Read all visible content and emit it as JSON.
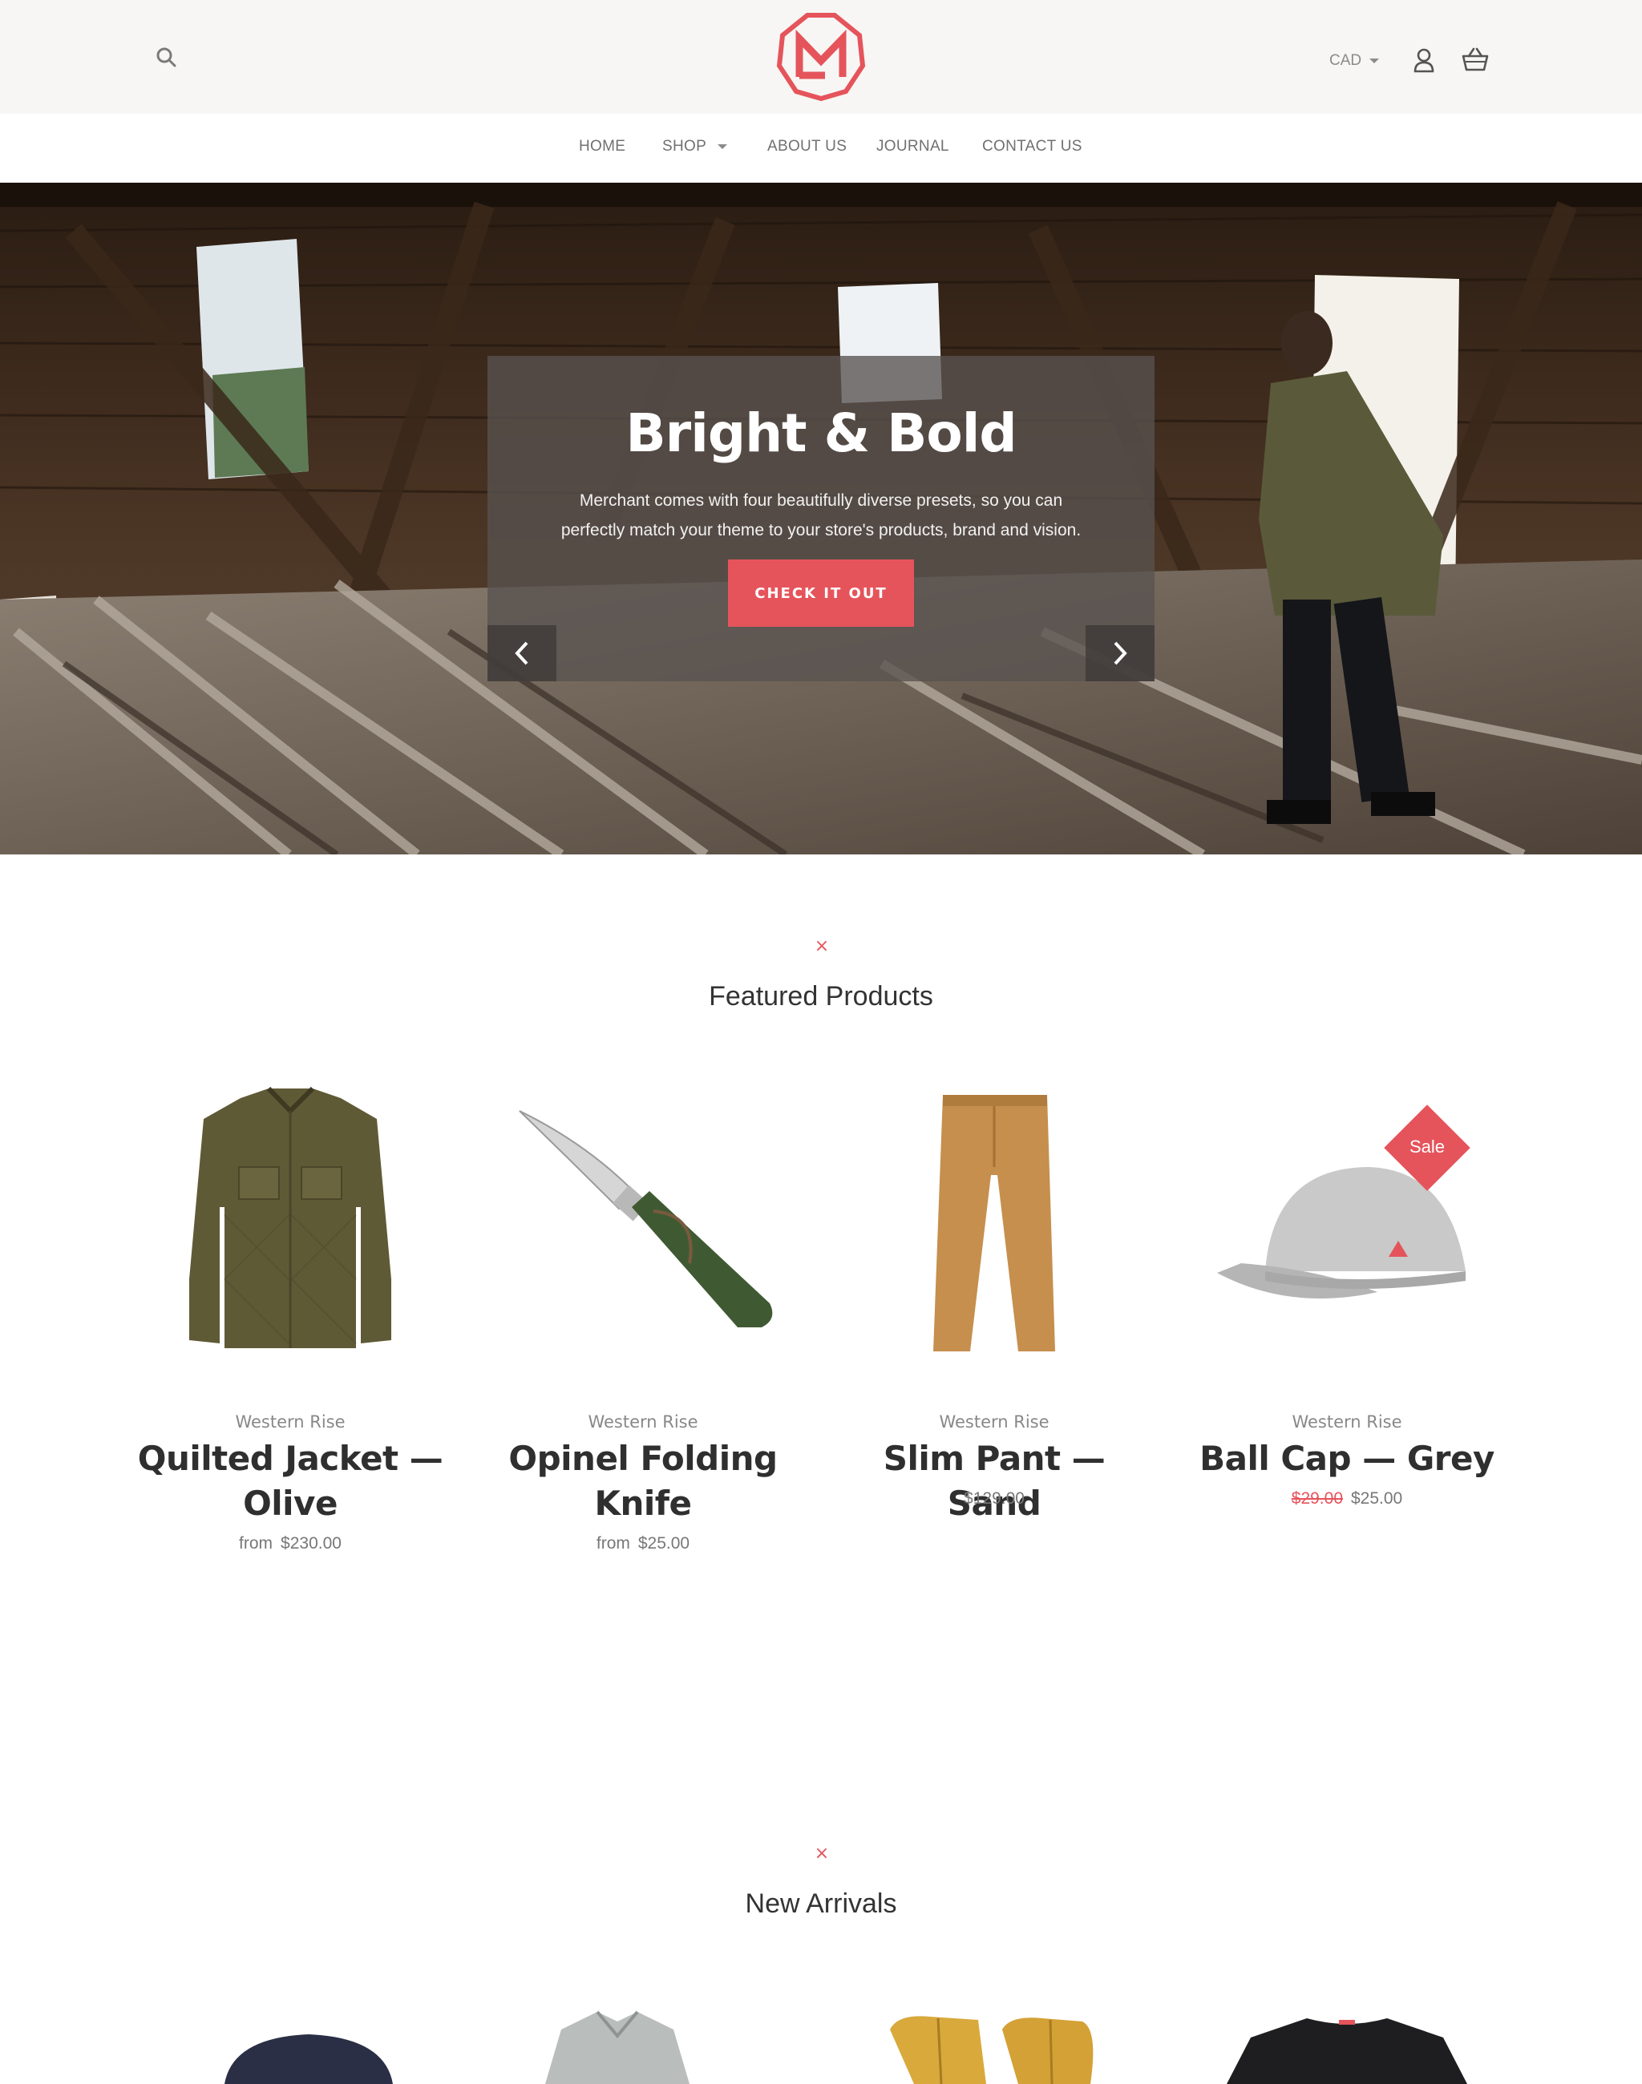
{
  "header": {
    "currency": "CAD",
    "icons": {
      "search": "search-icon",
      "account": "user-icon",
      "cart": "basket-icon",
      "logo": "octagon-m-logo"
    }
  },
  "nav": {
    "items": [
      {
        "label": "HOME"
      },
      {
        "label": "SHOP"
      },
      {
        "label": "ABOUT US"
      },
      {
        "label": "JOURNAL"
      },
      {
        "label": "CONTACT US"
      }
    ]
  },
  "hero": {
    "title": "Bright & Bold",
    "text": "Merchant comes with four beautifully diverse presets, so you can perfectly match your theme to your store's products, brand and vision.",
    "button": "CHECK IT OUT",
    "prev_icon": "chevron-left-icon",
    "next_icon": "chevron-right-icon"
  },
  "featured": {
    "mark": "×",
    "title": "Featured Products",
    "products": [
      {
        "vendor": "Western Rise",
        "name": "Quilted Jacket — Olive",
        "price_prefix": "from",
        "price": "$230.00"
      },
      {
        "vendor": "Western Rise",
        "name": "Opinel Folding Knife",
        "price_prefix": "from",
        "price": "$25.00"
      },
      {
        "vendor": "Western Rise",
        "name": "Slim Pant — Sand",
        "price": "$129.00"
      },
      {
        "vendor": "Western Rise",
        "name": "Ball Cap — Grey",
        "compare_price": "$29.00",
        "price": "$25.00",
        "badge": "Sale"
      }
    ]
  },
  "new_arrivals": {
    "mark": "×",
    "title": "New Arrivals"
  },
  "colors": {
    "accent": "#e5545b",
    "header_bg": "#f7f6f4",
    "text": "#2f2f2f"
  }
}
